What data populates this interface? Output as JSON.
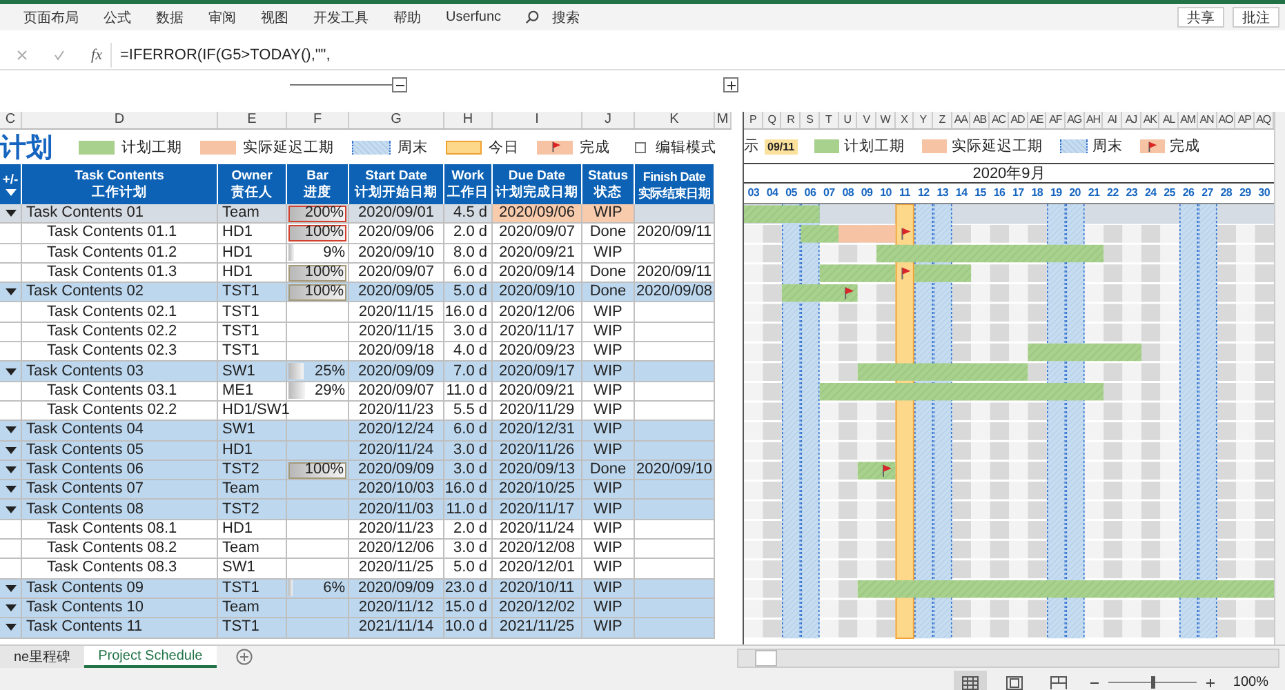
{
  "ribbon": {
    "tabs": [
      "页面布局",
      "公式",
      "数据",
      "审阅",
      "视图",
      "开发工具",
      "帮助",
      "Userfunc"
    ],
    "search": "搜索",
    "buttons": [
      "共享",
      "批注"
    ]
  },
  "formula_bar": {
    "fx": "fx",
    "formula": "=IFERROR(IF(G5>TODAY(),\"\","
  },
  "column_headers": [
    "C",
    "D",
    "E",
    "F",
    "G",
    "H",
    "I",
    "J",
    "K",
    "M"
  ],
  "gantt_column_headers": [
    "P",
    "Q",
    "R",
    "S",
    "T",
    "U",
    "V",
    "W",
    "X",
    "Y",
    "Z",
    "AA",
    "AB",
    "AC",
    "AD",
    "AE",
    "AF",
    "AG",
    "AH",
    "AI",
    "AJ",
    "AK",
    "AL",
    "AM",
    "AN",
    "AO",
    "AP",
    "AQ"
  ],
  "title": "计划",
  "legend": [
    {
      "kind": "plan",
      "label": "计划工期"
    },
    {
      "kind": "delay",
      "label": "实际延迟工期"
    },
    {
      "kind": "weekend",
      "label": "周末"
    },
    {
      "kind": "today",
      "label": "今日"
    },
    {
      "kind": "done",
      "label": "完成"
    }
  ],
  "edit_mode": {
    "label": "编辑模式",
    "checked": false
  },
  "table_header": [
    {
      "en": "+/-"
    },
    {
      "en": "Task Contents",
      "zh": "工作计划"
    },
    {
      "en": "Owner",
      "zh": "责任人"
    },
    {
      "en": "Bar",
      "zh": "进度"
    },
    {
      "en": "Start Date",
      "zh": "计划开始日期"
    },
    {
      "en": "Work",
      "zh": "工作日"
    },
    {
      "en": "Due Date",
      "zh": "计划完成日期"
    },
    {
      "en": "Status",
      "zh": "状态"
    },
    {
      "en": "Finish Date",
      "zh": "实际结束日期"
    }
  ],
  "tasks": [
    {
      "name": "Task Contents 01",
      "owner": "Team",
      "progress": {
        "text": "200%",
        "level": 1,
        "alert": true
      },
      "start": "2020/09/01",
      "work": "4.5 d",
      "due": "2020/09/06",
      "status": "WIP",
      "selected": true,
      "overdue": true,
      "timeline": [
        {
          "kind": "plan"
        },
        {
          "kind": "plan"
        },
        {
          "kind": "plan"
        },
        {
          "kind": "plan"
        }
      ],
      "children": [
        {
          "name": "Task Contents 01.1",
          "owner": "HD1",
          "progress": {
            "text": "100%",
            "level": 1,
            "alert": true
          },
          "start": "2020/09/06",
          "work": "2.0 d",
          "due": "2020/09/07",
          "status": "Done",
          "finish": "2020/09/11",
          "selected": false,
          "overdue": false,
          "timeline": [
            {
              "kind": "none"
            },
            {
              "kind": "none"
            },
            {
              "kind": "none"
            },
            {
              "kind": "plan"
            },
            {
              "kind": "plan"
            },
            {
              "kind": "delay"
            },
            {
              "kind": "delay"
            },
            {
              "kind": "delay"
            },
            {
              "kind": "done"
            }
          ]
        },
        {
          "name": "Task Contents 01.2",
          "owner": "HD1",
          "progress": {
            "text": "9%",
            "level": 0.09,
            "alert": false
          },
          "start": "2020/09/10",
          "work": "8.0 d",
          "due": "2020/09/21",
          "status": "WIP",
          "selected": false,
          "overdue": false,
          "timeline": [
            {
              "kind": "none"
            },
            {
              "kind": "none"
            },
            {
              "kind": "none"
            },
            {
              "kind": "none"
            },
            {
              "kind": "none"
            },
            {
              "kind": "none"
            },
            {
              "kind": "none"
            },
            {
              "kind": "plan"
            },
            {
              "kind": "plan"
            },
            {
              "kind": "plan"
            },
            {
              "kind": "plan"
            },
            {
              "kind": "plan"
            },
            {
              "kind": "plan"
            },
            {
              "kind": "plan"
            },
            {
              "kind": "plan"
            },
            {
              "kind": "plan"
            },
            {
              "kind": "plan"
            },
            {
              "kind": "plan"
            },
            {
              "kind": "plan"
            }
          ]
        },
        {
          "name": "Task Contents 01.3",
          "owner": "HD1",
          "progress": {
            "text": "100%",
            "level": 1,
            "alert": false
          },
          "start": "2020/09/07",
          "work": "6.0 d",
          "due": "2020/09/14",
          "status": "Done",
          "finish": "2020/09/11",
          "selected": false,
          "overdue": false,
          "timeline": [
            {
              "kind": "none"
            },
            {
              "kind": "none"
            },
            {
              "kind": "none"
            },
            {
              "kind": "none"
            },
            {
              "kind": "plan"
            },
            {
              "kind": "plan"
            },
            {
              "kind": "plan"
            },
            {
              "kind": "plan"
            },
            {
              "kind": "done"
            },
            {
              "kind": "plan"
            },
            {
              "kind": "plan"
            },
            {
              "kind": "plan"
            }
          ]
        }
      ]
    },
    {
      "name": "Task Contents 02",
      "owner": "TST1",
      "progress": {
        "text": "100%",
        "level": 1,
        "alert": false
      },
      "start": "2020/09/05",
      "work": "5.0 d",
      "due": "2020/09/10",
      "status": "Done",
      "finish": "2020/09/08",
      "selected": false,
      "overdue": false,
      "timeline": [
        {
          "kind": "none"
        },
        {
          "kind": "none"
        },
        {
          "kind": "plan"
        },
        {
          "kind": "plan"
        },
        {
          "kind": "plan"
        },
        {
          "kind": "plan_done"
        }
      ],
      "children": [
        {
          "name": "Task Contents 02.1",
          "owner": "TST1",
          "start": "2020/11/15",
          "work": "16.0 d",
          "due": "2020/12/06",
          "status": "WIP",
          "selected": false,
          "overdue": false
        },
        {
          "name": "Task Contents 02.2",
          "owner": "TST1",
          "start": "2020/11/15",
          "work": "3.0 d",
          "due": "2020/11/17",
          "status": "WIP",
          "selected": false,
          "overdue": false
        },
        {
          "name": "Task Contents 02.3",
          "owner": "TST1",
          "start": "2020/09/18",
          "work": "4.0 d",
          "due": "2020/09/23",
          "status": "WIP",
          "selected": false,
          "overdue": false,
          "timeline": [
            {
              "kind": "none"
            },
            {
              "kind": "none"
            },
            {
              "kind": "none"
            },
            {
              "kind": "none"
            },
            {
              "kind": "none"
            },
            {
              "kind": "none"
            },
            {
              "kind": "none"
            },
            {
              "kind": "none"
            },
            {
              "kind": "none"
            },
            {
              "kind": "none"
            },
            {
              "kind": "none"
            },
            {
              "kind": "none"
            },
            {
              "kind": "none"
            },
            {
              "kind": "none"
            },
            {
              "kind": "none"
            },
            {
              "kind": "plan"
            },
            {
              "kind": "plan"
            },
            {
              "kind": "plan"
            },
            {
              "kind": "plan"
            },
            {
              "kind": "plan"
            },
            {
              "kind": "plan"
            }
          ]
        }
      ]
    },
    {
      "name": "Task Contents 03",
      "owner": "SW1",
      "progress": {
        "text": "25%",
        "level": 0.25,
        "alert": false
      },
      "start": "2020/09/09",
      "work": "7.0 d",
      "due": "2020/09/17",
      "status": "WIP",
      "selected": false,
      "overdue": false,
      "timeline": [
        {
          "kind": "none"
        },
        {
          "kind": "none"
        },
        {
          "kind": "none"
        },
        {
          "kind": "none"
        },
        {
          "kind": "none"
        },
        {
          "kind": "none"
        },
        {
          "kind": "plan"
        },
        {
          "kind": "plan"
        },
        {
          "kind": "plan"
        },
        {
          "kind": "plan"
        },
        {
          "kind": "plan"
        },
        {
          "kind": "plan"
        },
        {
          "kind": "plan"
        },
        {
          "kind": "plan"
        },
        {
          "kind": "plan"
        }
      ],
      "children": [
        {
          "name": "Task Contents 03.1",
          "owner": "ME1",
          "progress": {
            "text": "29%",
            "level": 0.29,
            "alert": false
          },
          "start": "2020/09/07",
          "work": "11.0 d",
          "due": "2020/09/21",
          "status": "WIP",
          "selected": false,
          "overdue": false,
          "timeline": [
            {
              "kind": "none"
            },
            {
              "kind": "none"
            },
            {
              "kind": "none"
            },
            {
              "kind": "none"
            },
            {
              "kind": "plan"
            },
            {
              "kind": "plan"
            },
            {
              "kind": "plan"
            },
            {
              "kind": "plan"
            },
            {
              "kind": "plan"
            },
            {
              "kind": "plan"
            },
            {
              "kind": "plan"
            },
            {
              "kind": "plan"
            },
            {
              "kind": "plan"
            },
            {
              "kind": "plan"
            },
            {
              "kind": "plan"
            },
            {
              "kind": "plan"
            },
            {
              "kind": "plan"
            },
            {
              "kind": "plan"
            },
            {
              "kind": "plan"
            }
          ]
        },
        {
          "name": "Task Contents 02.2",
          "owner": "HD1/SW1",
          "start": "2020/11/23",
          "work": "5.5 d",
          "due": "2020/11/29",
          "status": "WIP",
          "selected": false,
          "overdue": false
        }
      ]
    },
    {
      "name": "Task Contents 04",
      "owner": "SW1",
      "start": "2020/12/24",
      "work": "6.0 d",
      "due": "2020/12/31",
      "status": "WIP",
      "selected": false,
      "overdue": false
    },
    {
      "name": "Task Contents 05",
      "owner": "HD1",
      "start": "2020/11/24",
      "work": "3.0 d",
      "due": "2020/11/26",
      "status": "WIP",
      "selected": false,
      "overdue": false
    },
    {
      "name": "Task Contents 06",
      "owner": "TST2",
      "progress": {
        "text": "100%",
        "level": 1,
        "alert": false
      },
      "start": "2020/09/09",
      "work": "3.0 d",
      "due": "2020/09/13",
      "status": "Done",
      "finish": "2020/09/10",
      "selected": false,
      "overdue": false,
      "timeline": [
        {
          "kind": "none"
        },
        {
          "kind": "none"
        },
        {
          "kind": "none"
        },
        {
          "kind": "none"
        },
        {
          "kind": "none"
        },
        {
          "kind": "none"
        },
        {
          "kind": "plan"
        },
        {
          "kind": "plan_done"
        }
      ]
    },
    {
      "name": "Task Contents 07",
      "owner": "Team",
      "start": "2020/10/03",
      "work": "16.0 d",
      "due": "2020/10/25",
      "status": "WIP",
      "selected": false,
      "overdue": false
    },
    {
      "name": "Task Contents 08",
      "owner": "TST2",
      "start": "2020/11/03",
      "work": "11.0 d",
      "due": "2020/11/17",
      "status": "WIP",
      "selected": false,
      "overdue": false,
      "children": [
        {
          "name": "Task Contents 08.1",
          "owner": "HD1",
          "start": "2020/11/23",
          "work": "2.0 d",
          "due": "2020/11/24",
          "status": "WIP",
          "selected": false,
          "overdue": false
        },
        {
          "name": "Task Contents 08.2",
          "owner": "Team",
          "start": "2020/12/06",
          "work": "3.0 d",
          "due": "2020/12/08",
          "status": "WIP",
          "selected": false,
          "overdue": false
        },
        {
          "name": "Task Contents 08.3",
          "owner": "SW1",
          "start": "2020/11/25",
          "work": "5.0 d",
          "due": "2020/12/01",
          "status": "WIP",
          "selected": false,
          "overdue": false
        }
      ]
    },
    {
      "name": "Task Contents 09",
      "owner": "TST1",
      "progress": {
        "text": "6%",
        "level": 0.06,
        "alert": false
      },
      "start": "2020/09/09",
      "work": "23.0 d",
      "due": "2020/10/11",
      "status": "WIP",
      "selected": false,
      "overdue": false,
      "timeline": [
        {
          "kind": "none"
        },
        {
          "kind": "none"
        },
        {
          "kind": "none"
        },
        {
          "kind": "none"
        },
        {
          "kind": "none"
        },
        {
          "kind": "none"
        },
        {
          "kind": "plan"
        },
        {
          "kind": "plan"
        },
        {
          "kind": "plan"
        },
        {
          "kind": "plan"
        },
        {
          "kind": "plan"
        },
        {
          "kind": "plan"
        },
        {
          "kind": "plan"
        },
        {
          "kind": "plan"
        },
        {
          "kind": "plan"
        },
        {
          "kind": "plan"
        },
        {
          "kind": "plan"
        },
        {
          "kind": "plan"
        },
        {
          "kind": "plan"
        },
        {
          "kind": "plan"
        },
        {
          "kind": "plan"
        },
        {
          "kind": "plan"
        },
        {
          "kind": "plan"
        },
        {
          "kind": "plan"
        },
        {
          "kind": "plan"
        },
        {
          "kind": "plan"
        },
        {
          "kind": "plan"
        },
        {
          "kind": "plan"
        }
      ]
    },
    {
      "name": "Task Contents 10",
      "owner": "Team",
      "start": "2020/11/12",
      "work": "15.0 d",
      "due": "2020/12/02",
      "status": "WIP",
      "selected": false,
      "overdue": false
    },
    {
      "name": "Task Contents 11",
      "owner": "TST1",
      "start": "2021/11/14",
      "work": "10.0 d",
      "due": "2021/11/25",
      "status": "WIP",
      "selected": false,
      "overdue": false
    }
  ],
  "gantt": {
    "display_label": "示",
    "display_date": "09/11",
    "legend": [
      {
        "kind": "plan",
        "label": "计划工期"
      },
      {
        "kind": "delay",
        "label": "实际延迟工期"
      },
      {
        "kind": "weekend",
        "label": "周末"
      },
      {
        "kind": "done",
        "label": "完成"
      }
    ],
    "month": "2020年9月",
    "days": [
      {
        "label": "03",
        "weekend": false,
        "today": false
      },
      {
        "label": "04",
        "weekend": false,
        "today": false
      },
      {
        "label": "05",
        "weekend": true,
        "today": false
      },
      {
        "label": "06",
        "weekend": true,
        "today": false
      },
      {
        "label": "07",
        "weekend": false,
        "today": false
      },
      {
        "label": "08",
        "weekend": false,
        "today": false
      },
      {
        "label": "09",
        "weekend": false,
        "today": false
      },
      {
        "label": "10",
        "weekend": false,
        "today": false
      },
      {
        "label": "11",
        "weekend": false,
        "today": true
      },
      {
        "label": "12",
        "weekend": true,
        "today": false
      },
      {
        "label": "13",
        "weekend": true,
        "today": false
      },
      {
        "label": "14",
        "weekend": false,
        "today": false
      },
      {
        "label": "15",
        "weekend": false,
        "today": false
      },
      {
        "label": "16",
        "weekend": false,
        "today": false
      },
      {
        "label": "17",
        "weekend": false,
        "today": false
      },
      {
        "label": "18",
        "weekend": false,
        "today": false
      },
      {
        "label": "19",
        "weekend": true,
        "today": false
      },
      {
        "label": "20",
        "weekend": true,
        "today": false
      },
      {
        "label": "21",
        "weekend": false,
        "today": false
      },
      {
        "label": "22",
        "weekend": false,
        "today": false
      },
      {
        "label": "23",
        "weekend": false,
        "today": false
      },
      {
        "label": "24",
        "weekend": false,
        "today": false
      },
      {
        "label": "25",
        "weekend": false,
        "today": false
      },
      {
        "label": "26",
        "weekend": true,
        "today": false
      },
      {
        "label": "27",
        "weekend": true,
        "today": false
      },
      {
        "label": "28",
        "weekend": false,
        "today": false
      },
      {
        "label": "29",
        "weekend": false,
        "today": false
      },
      {
        "label": "30",
        "weekend": false,
        "today": false
      }
    ]
  },
  "sheet_tabs": [
    {
      "label": "ne里程碑",
      "selected": false
    },
    {
      "label": "Project Schedule",
      "selected": true
    }
  ],
  "status_bar": {
    "views": [
      {
        "kind": "normal",
        "selected": true
      },
      {
        "kind": "layout",
        "selected": false
      },
      {
        "kind": "break",
        "selected": false
      }
    ],
    "zoom_slider": {
      "level": 0.5
    },
    "zoom": "100%"
  }
}
